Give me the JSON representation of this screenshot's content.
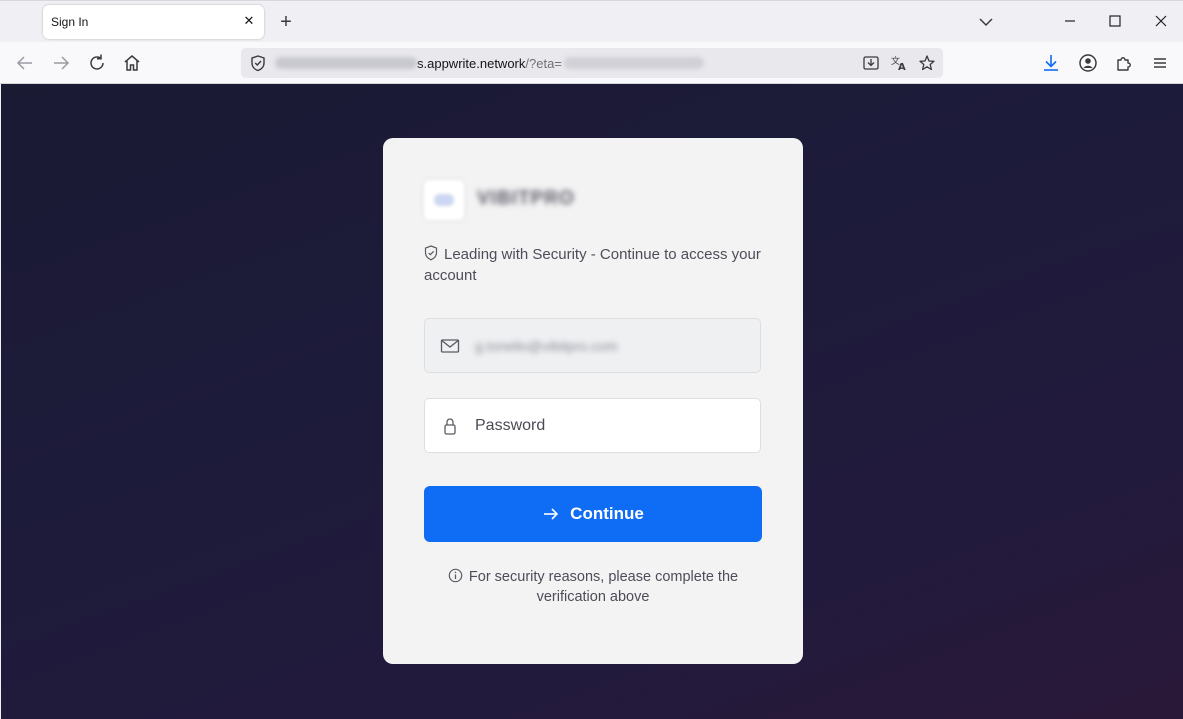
{
  "browser": {
    "tab_title": "Sign In",
    "tab_close": "✕",
    "new_tab": "+",
    "url": {
      "domain": "s.appwrite.network",
      "path": "/?eta="
    }
  },
  "card": {
    "brand": "VIBITPRO",
    "tagline": "Leading with Security - Continue to access your account",
    "email_value": "g.tonello@vibitpro.com",
    "password_placeholder": "Password",
    "continue_label": "Continue",
    "note": "For security reasons, please complete the verification above"
  },
  "colors": {
    "primary": "#0f6cf5",
    "card_bg": "#f3f3f4",
    "page_bg": "#1d1b3a"
  }
}
